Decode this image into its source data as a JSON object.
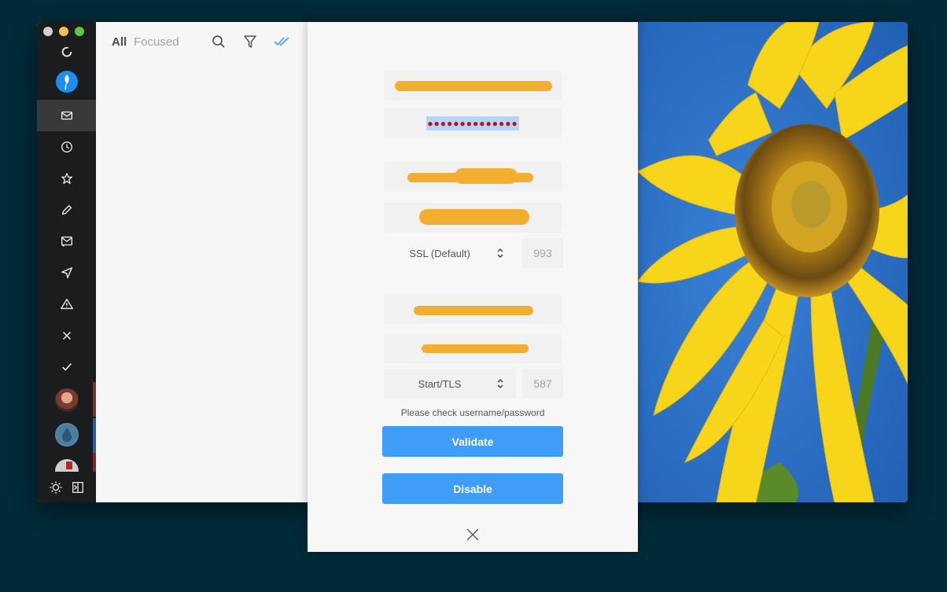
{
  "list": {
    "tab_all": "All",
    "tab_focused": "Focused"
  },
  "icons": {
    "sidebar": [
      "sync-icon",
      "app-logo-icon",
      "inbox-icon",
      "clock-icon",
      "star-icon",
      "pencil-icon",
      "mail-sent-icon",
      "send-icon",
      "warning-icon",
      "close-icon",
      "check-icon"
    ],
    "toolbar": [
      "search-icon",
      "filter-icon",
      "double-check-icon"
    ],
    "bottom": [
      "sun-icon",
      "sidebar-toggle-icon"
    ]
  },
  "dialog": {
    "password_mask": "●●●●●●●●●●●●●●",
    "incoming_security": "SSL (Default)",
    "incoming_port": "993",
    "outgoing_security": "Start/TLS",
    "outgoing_port": "587",
    "hint": "Please check username/password",
    "validate_label": "Validate",
    "disable_label": "Disable"
  },
  "colors": {
    "accent": "#3f9cf7",
    "redaction": "#f2ae2e",
    "sidebar_bg": "#1b1c1e",
    "background": "#012a38"
  }
}
